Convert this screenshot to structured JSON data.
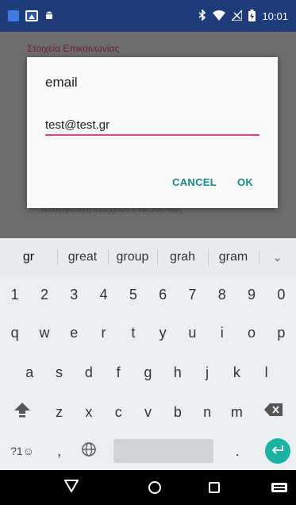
{
  "status_bar": {
    "time": "10:01",
    "icons": [
      "notification-square-icon",
      "image-icon",
      "android-icon",
      "bluetooth-icon",
      "wifi-icon",
      "no-signal-icon",
      "battery-icon"
    ]
  },
  "background_app": {
    "heading": "Στοιχεία Επικοινωνίας",
    "obscured_text": "Αποθήκευση στοιχείων επικοινωνίας"
  },
  "dialog": {
    "title": "email",
    "input_value": "test@test.gr",
    "cancel_label": "CANCEL",
    "ok_label": "OK",
    "accent_color": "#e5467a",
    "button_color": "#138a88"
  },
  "keyboard": {
    "suggestions": [
      "gr",
      "great",
      "group",
      "grah",
      "gram"
    ],
    "expand_icon": "⌄",
    "number_row": [
      "1",
      "2",
      "3",
      "4",
      "5",
      "6",
      "7",
      "8",
      "9",
      "0"
    ],
    "row_q": [
      "q",
      "w",
      "e",
      "r",
      "t",
      "y",
      "u",
      "i",
      "o",
      "p"
    ],
    "row_a": [
      "a",
      "s",
      "d",
      "f",
      "g",
      "h",
      "j",
      "k",
      "l"
    ],
    "row_z": [
      "z",
      "x",
      "c",
      "v",
      "b",
      "n",
      "m"
    ],
    "symbols_label": "?1☺",
    "comma_label": ",",
    "period_label": ".",
    "enter_color": "#1ab3a3"
  },
  "nav_bar": {
    "icons": [
      "back-icon",
      "home-icon",
      "recents-icon",
      "keyboard-switch-icon"
    ]
  }
}
